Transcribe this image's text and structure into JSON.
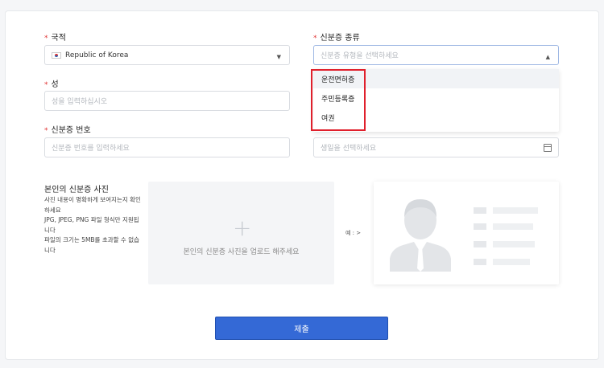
{
  "form": {
    "nationality": {
      "label": "국적",
      "value": "Republic of Korea"
    },
    "id_type": {
      "label": "신분증 종류",
      "placeholder": "신분증 유형을 선택하세요",
      "options": [
        "운전면허증",
        "주민등록증",
        "여권"
      ]
    },
    "surname": {
      "label": "성",
      "placeholder": "성을 입력하십시오"
    },
    "id_number": {
      "label": "신분증 번호",
      "placeholder": "신분증 번호를 입력하세요"
    },
    "birthdate": {
      "placeholder": "생일을 선택하세요"
    },
    "required_mark": "*"
  },
  "photo": {
    "title": "본인의 신분증 사진",
    "desc1": "사진 내용이 명확하게 보여지는지 확인하세요",
    "desc2": "JPG, JPEG, PNG 파일 형식만 지원됩니다",
    "desc3": "파일의 크기는 5MB를 초과할 수 없습니다",
    "upload_text": "본인의 신분증 사진을 업로드 해주세요",
    "example_label": "예 : >"
  },
  "submit_label": "제출",
  "colors": {
    "accent": "#3469d6",
    "required": "#e03131",
    "highlight": "#e0202c"
  }
}
